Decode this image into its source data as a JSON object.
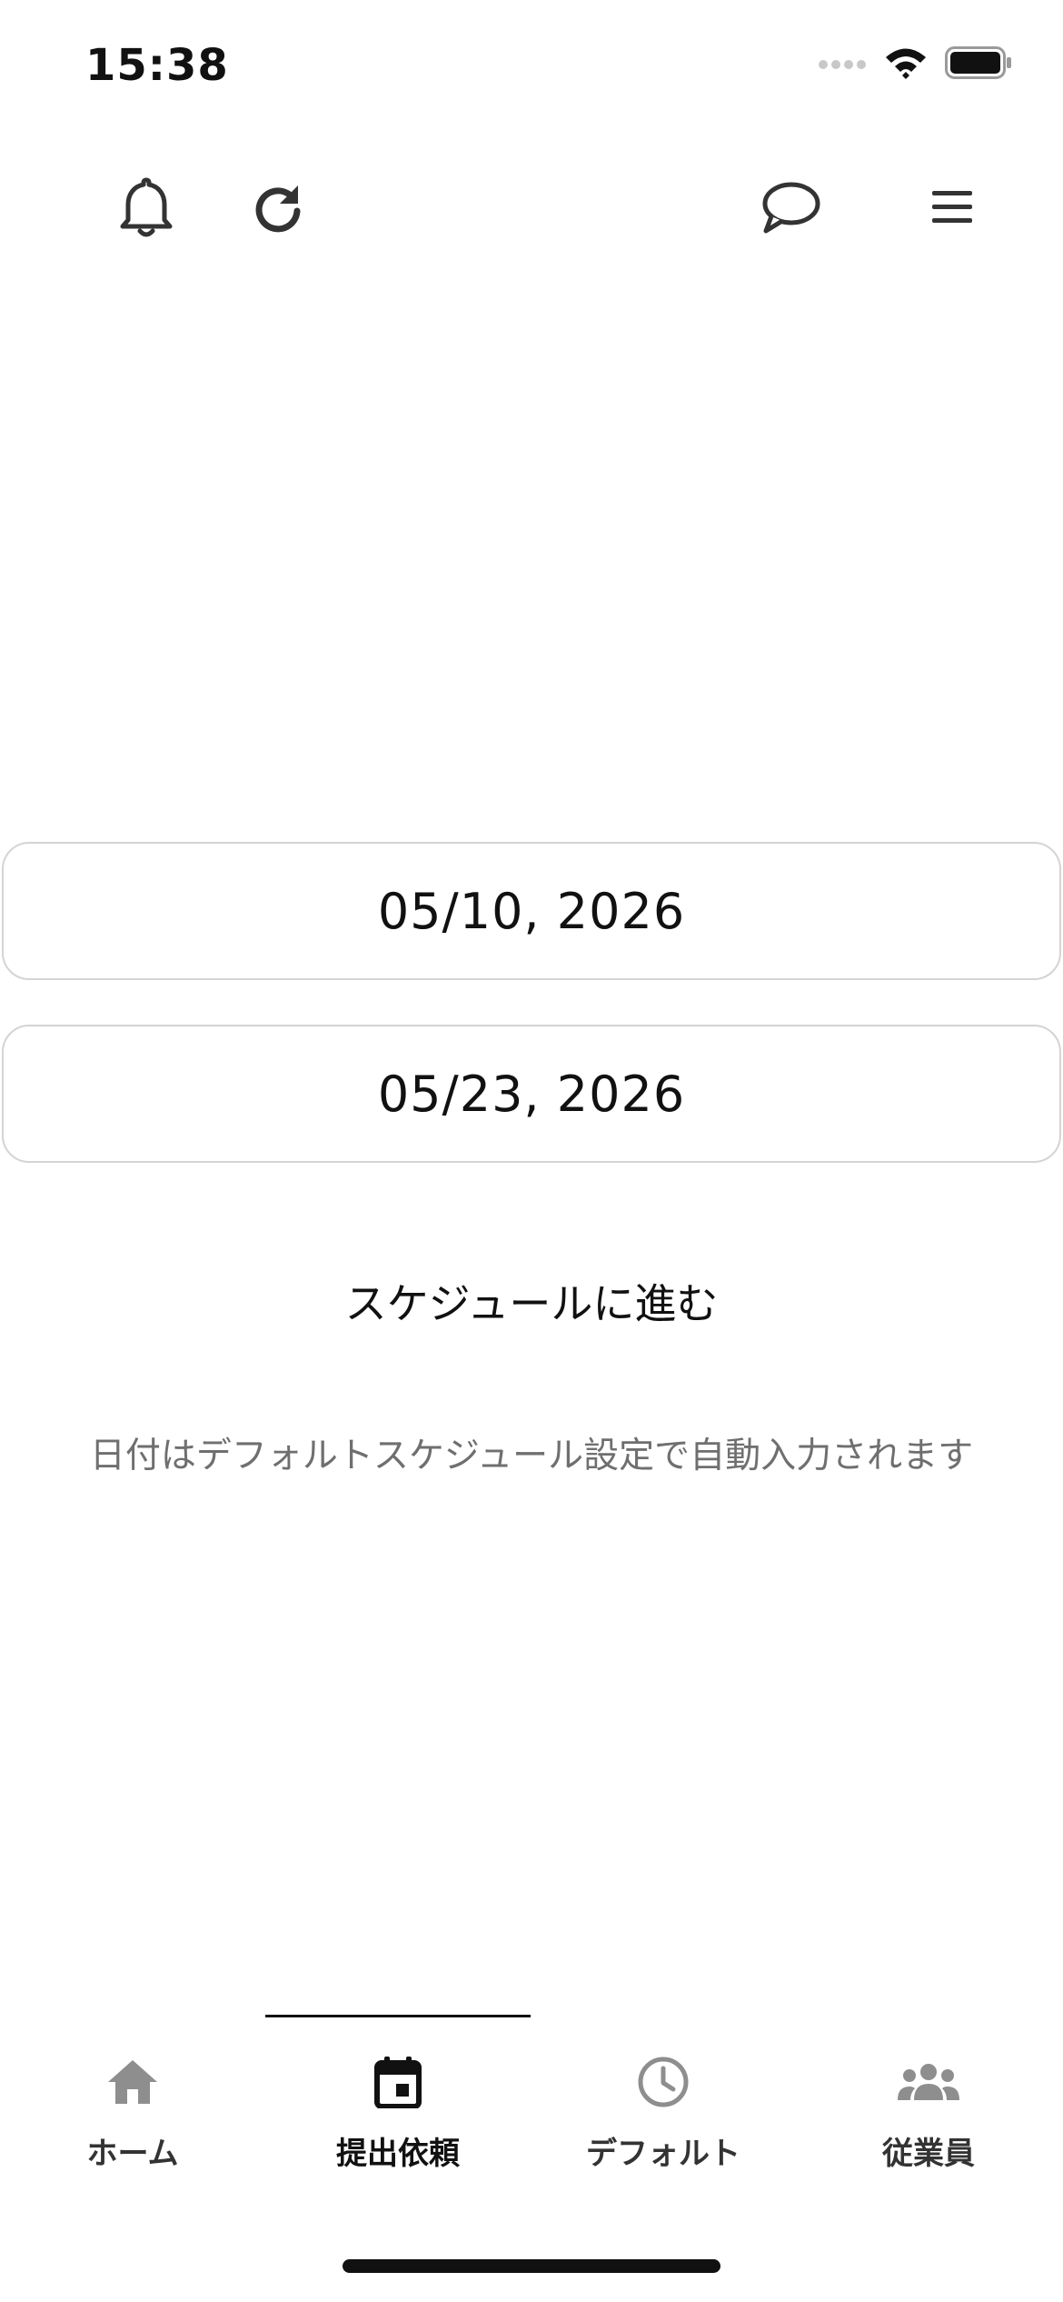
{
  "status_bar": {
    "time": "15:38"
  },
  "toolbar": {
    "icons": [
      "bell-icon",
      "refresh-icon",
      "chat-icon",
      "menu-icon"
    ]
  },
  "form": {
    "start_date": "05/10, 2026",
    "end_date": "05/23, 2026",
    "proceed_label": "スケジュールに進む",
    "hint": "日付はデフォルトスケジュール設定で自動入力されます"
  },
  "bottom_nav": {
    "active_index": 1,
    "tabs": [
      {
        "label": "ホーム",
        "icon": "home-icon"
      },
      {
        "label": "提出依頼",
        "icon": "calendar-icon"
      },
      {
        "label": "デフォルト",
        "icon": "clock-icon"
      },
      {
        "label": "従業員",
        "icon": "group-icon"
      }
    ]
  },
  "colors": {
    "text": "#111111",
    "muted_text": "#6f6f6f",
    "inactive_icon": "#8e8e8e",
    "border": "#d4d4d4"
  }
}
